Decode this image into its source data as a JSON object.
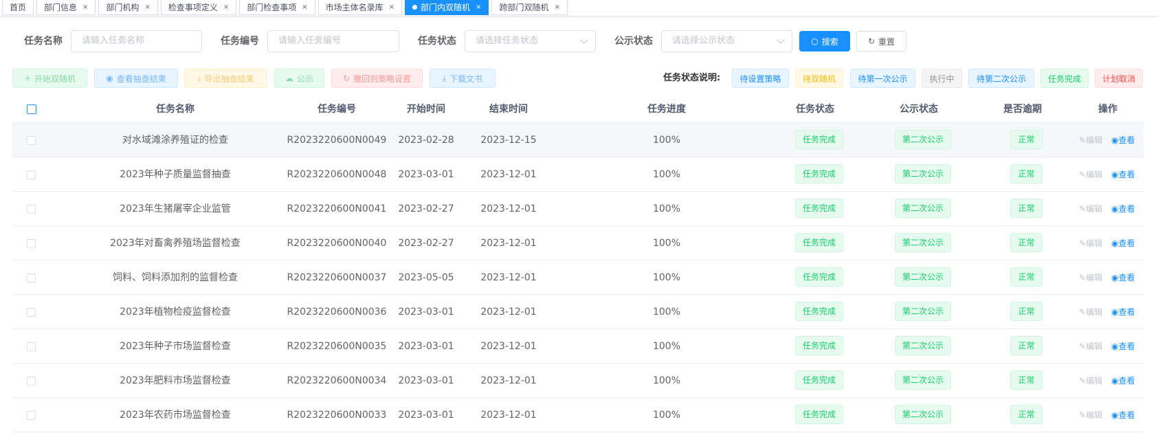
{
  "tabs": [
    {
      "label": "首页",
      "closable": false,
      "active": false
    },
    {
      "label": "部门信息",
      "closable": true,
      "active": false
    },
    {
      "label": "部门机构",
      "closable": true,
      "active": false
    },
    {
      "label": "检查事项定义",
      "closable": true,
      "active": false
    },
    {
      "label": "部门检查事项",
      "closable": true,
      "active": false
    },
    {
      "label": "市场主体名录库",
      "closable": true,
      "active": false
    },
    {
      "label": "部门内双随机",
      "closable": true,
      "active": true
    },
    {
      "label": "跨部门双随机",
      "closable": true,
      "active": false
    }
  ],
  "search": {
    "task_name_label": "任务名称",
    "task_name_placeholder": "请输入任务名称",
    "task_no_label": "任务编号",
    "task_no_placeholder": "请输入任务编号",
    "task_status_label": "任务状态",
    "task_status_placeholder": "请选择任务状态",
    "public_status_label": "公示状态",
    "public_status_placeholder": "请选择公示状态",
    "search_button": "搜索",
    "reset_button": "重置"
  },
  "toolbar": {
    "start": "开始双随机",
    "view_results": "查看抽查结果",
    "export_results": "导出抽查结果",
    "publicize": "公示",
    "revert": "撤回到策略设置",
    "download": "下载文书"
  },
  "legend": {
    "label": "任务状态说明:",
    "items": [
      "待设置策略",
      "待双随机",
      "待第一次公示",
      "执行中",
      "待第二次公示",
      "任务完成",
      "计划取消"
    ]
  },
  "table": {
    "columns": [
      "任务名称",
      "任务编号",
      "开始时间",
      "结束时间",
      "任务进度",
      "任务状态",
      "公示状态",
      "是否逾期",
      "操作"
    ],
    "edit_label": "编辑",
    "view_label": "查看",
    "rows": [
      {
        "name": "对水域滩涂养殖证的检查",
        "no": "R2023220600N0049",
        "start": "2023-02-28",
        "end": "2023-12-15",
        "progress": "100%",
        "status": "任务完成",
        "public": "第二次公示",
        "overdue": "正常"
      },
      {
        "name": "2023年种子质量监督抽查",
        "no": "R2023220600N0048",
        "start": "2023-03-01",
        "end": "2023-12-01",
        "progress": "100%",
        "status": "任务完成",
        "public": "第二次公示",
        "overdue": "正常"
      },
      {
        "name": "2023年生猪屠宰企业监管",
        "no": "R2023220600N0041",
        "start": "2023-02-27",
        "end": "2023-12-01",
        "progress": "100%",
        "status": "任务完成",
        "public": "第二次公示",
        "overdue": "正常"
      },
      {
        "name": "2023年对畜禽养殖场监督检查",
        "no": "R2023220600N0040",
        "start": "2023-02-27",
        "end": "2023-12-01",
        "progress": "100%",
        "status": "任务完成",
        "public": "第二次公示",
        "overdue": "正常"
      },
      {
        "name": "饲料、饲料添加剂的监督检查",
        "no": "R2023220600N0037",
        "start": "2023-05-05",
        "end": "2023-12-01",
        "progress": "100%",
        "status": "任务完成",
        "public": "第二次公示",
        "overdue": "正常"
      },
      {
        "name": "2023年植物检疫监督检查",
        "no": "R2023220600N0036",
        "start": "2023-03-01",
        "end": "2023-12-01",
        "progress": "100%",
        "status": "任务完成",
        "public": "第二次公示",
        "overdue": "正常"
      },
      {
        "name": "2023年种子市场监督检查",
        "no": "R2023220600N0035",
        "start": "2023-03-01",
        "end": "2023-12-01",
        "progress": "100%",
        "status": "任务完成",
        "public": "第二次公示",
        "overdue": "正常"
      },
      {
        "name": "2023年肥料市场监督检查",
        "no": "R2023220600N0034",
        "start": "2023-03-01",
        "end": "2023-12-01",
        "progress": "100%",
        "status": "任务完成",
        "public": "第二次公示",
        "overdue": "正常"
      },
      {
        "name": "2023年农药市场监督检查",
        "no": "R2023220600N0033",
        "start": "2023-03-01",
        "end": "2023-12-01",
        "progress": "100%",
        "status": "任务完成",
        "public": "第二次公示",
        "overdue": "正常"
      }
    ]
  }
}
